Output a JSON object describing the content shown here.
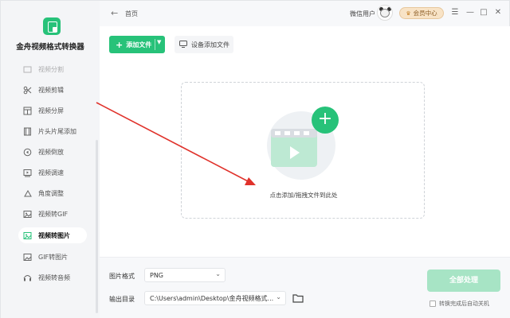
{
  "app": {
    "name": "金舟视频格式转换器",
    "accent": "#27c279"
  },
  "sidebar": {
    "items": [
      {
        "label": "视频分割",
        "icon": "cut-icon",
        "partial": true
      },
      {
        "label": "视频剪辑",
        "icon": "scissors-icon"
      },
      {
        "label": "视频分屏",
        "icon": "split-screen-icon"
      },
      {
        "label": "片头片尾添加",
        "icon": "film-strip-icon"
      },
      {
        "label": "视频倒放",
        "icon": "rewind-icon"
      },
      {
        "label": "视频调速",
        "icon": "speed-icon"
      },
      {
        "label": "角度调整",
        "icon": "rotate-icon"
      },
      {
        "label": "视频转GIF",
        "icon": "gif-icon"
      },
      {
        "label": "视频转图片",
        "icon": "image-icon",
        "active": true
      },
      {
        "label": "GIF转图片",
        "icon": "gif-image-icon"
      },
      {
        "label": "视频转音频",
        "icon": "audio-icon"
      }
    ]
  },
  "titlebar": {
    "breadcrumb": "首页",
    "user": "微信用户",
    "vip_label": "会员中心"
  },
  "toolbar": {
    "add_file": "添加文件",
    "device_add": "设备添加文件"
  },
  "dropzone": {
    "hint": "点击添加/拖拽文件到此处"
  },
  "bottom": {
    "format_label": "图片格式",
    "format_value": "PNG",
    "output_label": "输出目录",
    "output_value": "C:\\Users\\admin\\Desktop\\金舟视频格式...",
    "convert_all": "全部处理",
    "shutdown_label": "转换完成后自动关机"
  }
}
